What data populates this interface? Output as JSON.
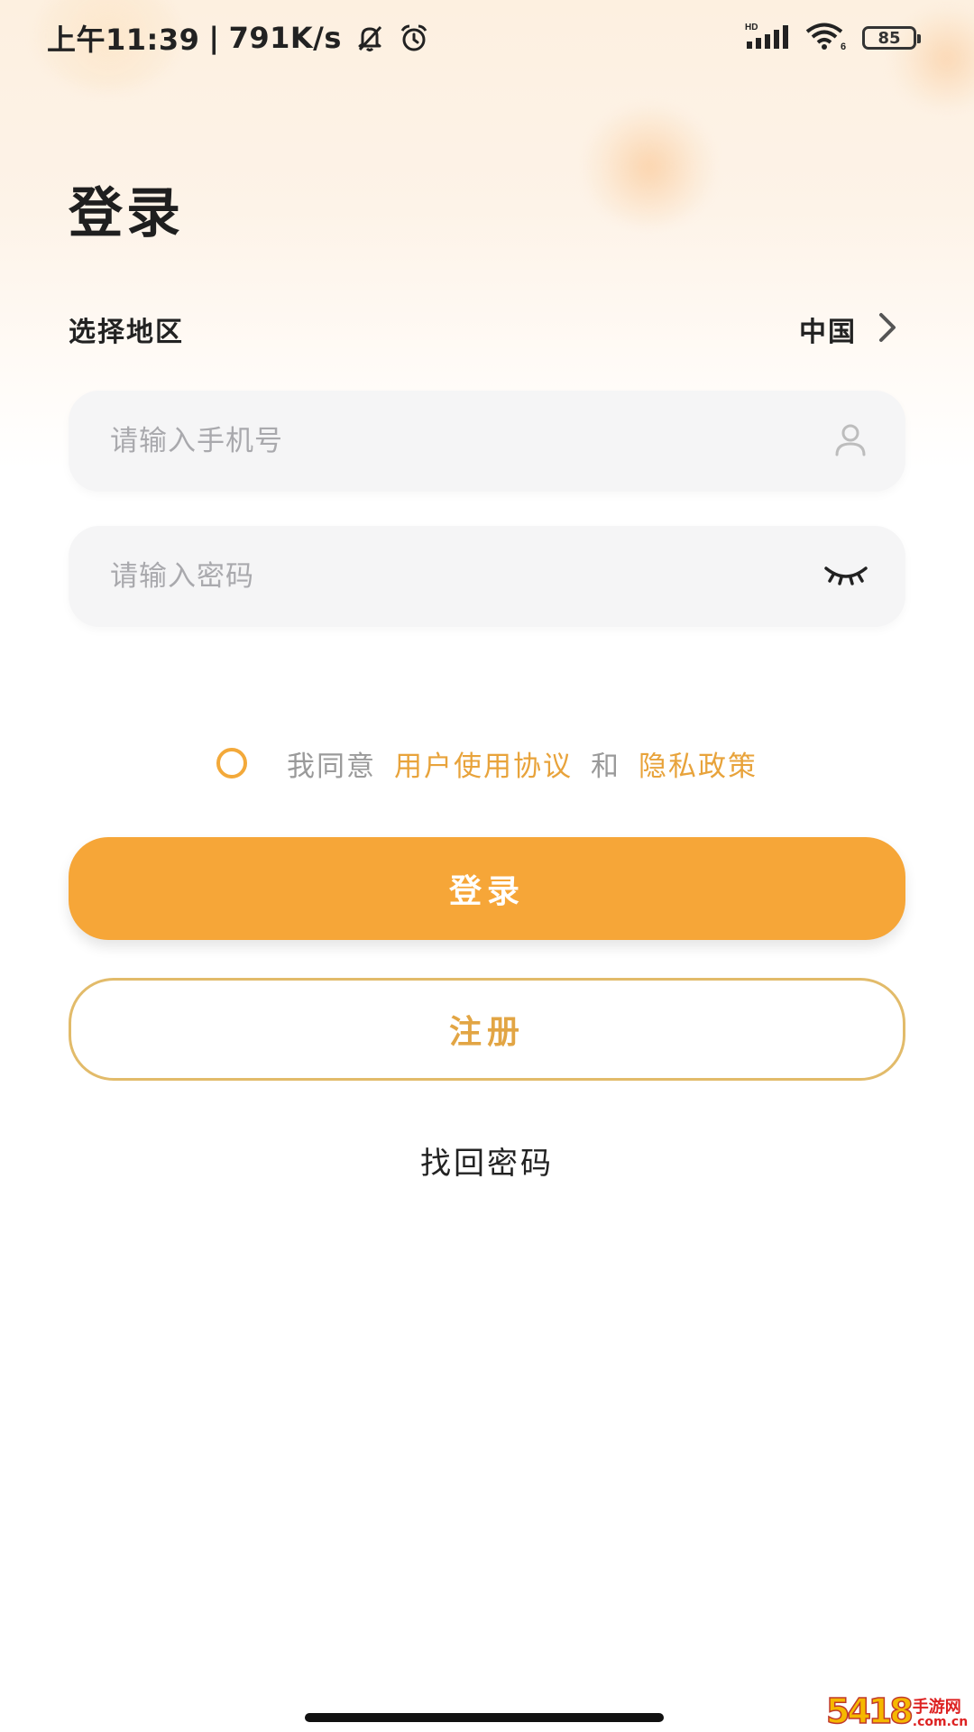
{
  "status_bar": {
    "time": "上午11:39",
    "separator": "|",
    "net_speed": "791K/s",
    "battery": "85",
    "network_label": "HD",
    "wifi_label": "6"
  },
  "header": {
    "title": "登录"
  },
  "region": {
    "label": "选择地区",
    "value": "中国"
  },
  "form": {
    "phone_placeholder": "请输入手机号",
    "password_placeholder": "请输入密码"
  },
  "agreement": {
    "prefix": "我同意",
    "terms_link": "用户使用协议",
    "conjunction": "和",
    "privacy_link": "隐私政策"
  },
  "actions": {
    "login_label": "登录",
    "register_label": "注册",
    "forgot_label": "找回密码"
  },
  "watermark": {
    "main": "5418",
    "cn": "手游网",
    "domain": ".com.cn"
  },
  "colors": {
    "accent": "#f6a638",
    "link": "#e8a33b",
    "border_gold": "#e2bb6a"
  }
}
